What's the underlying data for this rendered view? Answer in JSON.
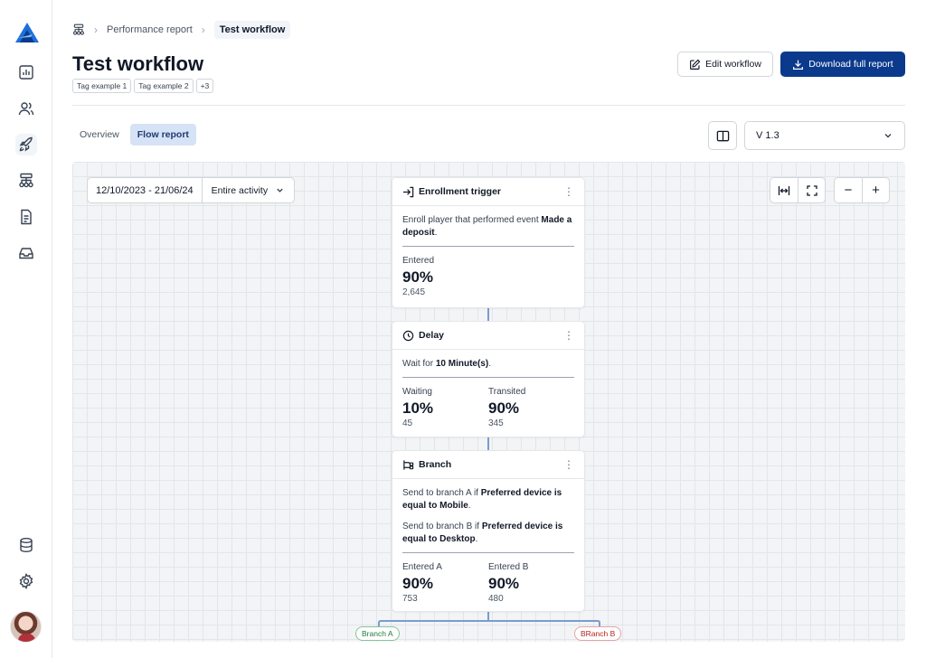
{
  "sidebar": {
    "icons": [
      "chart-icon",
      "users-icon",
      "rocket-icon",
      "workflow-icon",
      "document-icon",
      "inbox-icon",
      "database-icon",
      "gear-icon"
    ]
  },
  "breadcrumb": {
    "items": [
      "Performance report",
      "Test workflow"
    ]
  },
  "header": {
    "title": "Test workflow",
    "tags": [
      "Tag example 1",
      "Tag example 2",
      "+3"
    ],
    "edit_label": "Edit workflow",
    "download_label": "Download full report"
  },
  "tabs": [
    {
      "label": "Overview",
      "active": false
    },
    {
      "label": "Flow report",
      "active": true
    }
  ],
  "version": {
    "selected": "V 1.3"
  },
  "canvas": {
    "date_range": "12/10/2023 - 21/06/24",
    "activity_filter": "Entire activity"
  },
  "nodes": {
    "enrollment": {
      "title": "Enrollment trigger",
      "desc_pre": "Enroll player that performed event ",
      "desc_bold": "Made a deposit",
      "desc_post": ".",
      "stats": [
        {
          "label": "Entered",
          "pct": "90%",
          "count": "2,645"
        }
      ]
    },
    "delay": {
      "title": "Delay",
      "desc_pre": "Wait for ",
      "desc_bold": "10 Minute(s)",
      "desc_post": ".",
      "stats": [
        {
          "label": "Waiting",
          "pct": "10%",
          "count": "45"
        },
        {
          "label": "Transited",
          "pct": "90%",
          "count": "345"
        }
      ]
    },
    "branch": {
      "title": "Branch",
      "desc1_pre": "Send to branch A if ",
      "desc1_bold": "Preferred device is equal to Mobile",
      "desc1_post": ".",
      "desc2_pre": "Send to branch B if ",
      "desc2_bold": "Preferred device is equal to Desktop",
      "desc2_post": ".",
      "stats": [
        {
          "label": "Entered A",
          "pct": "90%",
          "count": "753"
        },
        {
          "label": "Entered B",
          "pct": "90%",
          "count": "480"
        }
      ]
    }
  },
  "branch_labels": [
    "Branch A",
    "BRanch B"
  ],
  "colors": {
    "primary": "#0b3a8c",
    "active_tab_bg": "#d6e2f5",
    "connector": "#7a9ccf",
    "branch_a": "#1f7a3e",
    "branch_b": "#b42318"
  }
}
